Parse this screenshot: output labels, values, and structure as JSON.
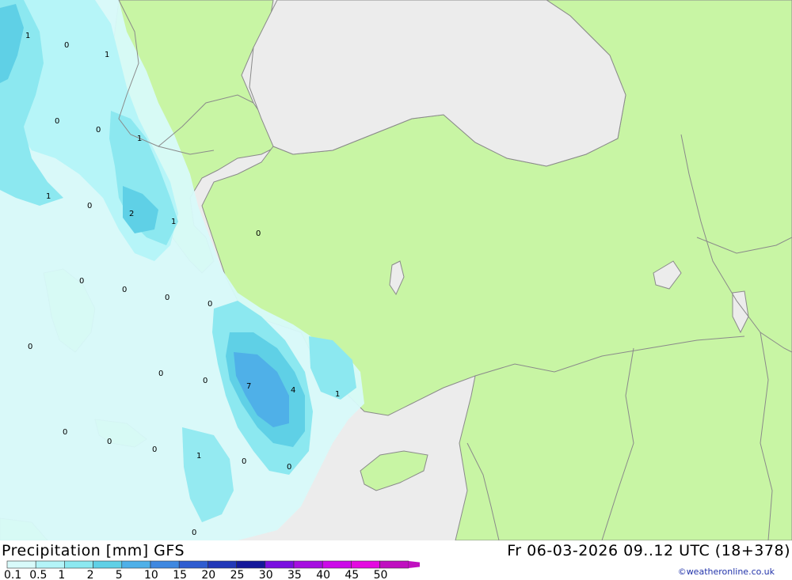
{
  "title_left": "Precipitation [mm] GFS",
  "title_right": "Fr 06-03-2026 09..12 UTC (18+378)",
  "credit": "©weatheronline.co.uk",
  "legend": {
    "values": [
      "0.1",
      "0.5",
      "1",
      "2",
      "5",
      "10",
      "15",
      "20",
      "25",
      "30",
      "35",
      "40",
      "45",
      "50"
    ],
    "colors": [
      "#d8fafa",
      "#b4f4f8",
      "#8ce8f0",
      "#5fd0e6",
      "#4fb0e8",
      "#3f88e0",
      "#2f5cd0",
      "#2238b8",
      "#15189a",
      "#7a10e0",
      "#a60ee0",
      "#cc0ae8",
      "#e40ae0",
      "#c010c0"
    ]
  },
  "colors": {
    "land": "#c8f5a4",
    "sea": "#ececec",
    "border": "#8a8a8a"
  },
  "map_labels": [
    "1",
    "0",
    "1",
    "0",
    "0",
    "1",
    "1",
    "0",
    "2",
    "1",
    "0",
    "0",
    "0",
    "0",
    "0",
    "0",
    "0",
    "0",
    "7",
    "4",
    "1",
    "0",
    "0",
    "0",
    "1",
    "0",
    "0",
    "0"
  ]
}
